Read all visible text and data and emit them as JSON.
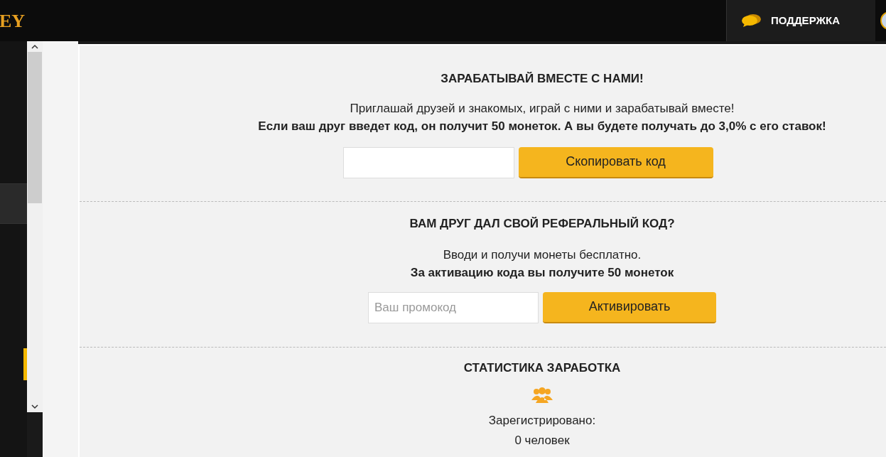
{
  "header": {
    "logo": "EY",
    "support_button": "ПОДДЕРЖКА"
  },
  "invite": {
    "title": "ЗАРАБАТЫВАЙ ВМЕСТЕ С НАМИ!",
    "text": "Приглашай друзей и знакомых, играй с ними и зарабатывай вместе!",
    "note": "Если ваш друг введет код, он получит 50 монеток. А вы будете получать до 3,0% с его ставок!",
    "button": "Скопировать код"
  },
  "activate": {
    "title": "ВАМ ДРУГ ДАЛ СВОЙ РЕФЕРАЛЬНЫЙ КОД?",
    "text": "Вводи и получи монеты бесплатно.",
    "note": "За активацию кода вы получите 50 монеток",
    "placeholder": "Ваш промокод",
    "button": "Активировать"
  },
  "stats": {
    "title": "СТАТИСТИКА ЗАРАБОТКА",
    "label": "Зарегистрировано:",
    "value": "0 человек"
  }
}
